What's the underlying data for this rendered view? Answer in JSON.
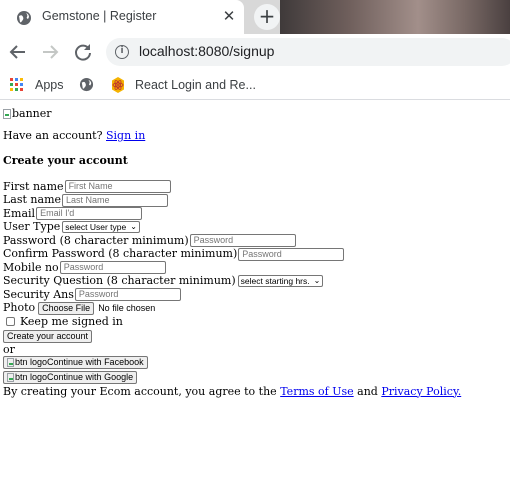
{
  "browser": {
    "tab_title": "Gemstone | Register",
    "tab_close": "✕",
    "new_tab": "+",
    "url": "localhost:8080/signup",
    "bookmarks": [
      {
        "label": "Apps",
        "icon": "apps-grid-icon"
      },
      {
        "label": "",
        "icon": "globe-icon"
      },
      {
        "label": "React Login and Re...",
        "icon": "react-icon"
      }
    ]
  },
  "page": {
    "banner_alt": "banner",
    "have_account": "Have an account?",
    "sign_in": "Sign in",
    "create_title": "Create your account",
    "fields": {
      "first_name": {
        "label": "First name",
        "placeholder": "First Name"
      },
      "last_name": {
        "label": "Last name",
        "placeholder": "Last Name"
      },
      "email": {
        "label": "Email",
        "placeholder": "Email I'd"
      },
      "user_type": {
        "label": "User Type",
        "selected": "select User type"
      },
      "password": {
        "label": "Password (8 character minimum)",
        "placeholder": "Password"
      },
      "confirm_password": {
        "label": "Confirm Password (8 character minimum)",
        "placeholder": "Password"
      },
      "mobile": {
        "label": "Mobile no",
        "placeholder": "Password"
      },
      "security_question": {
        "label": "Security Question (8 character minimum)",
        "selected": "select starting hrs."
      },
      "security_answer": {
        "label": "Security Ans",
        "placeholder": "Password"
      },
      "photo": {
        "label": "Photo",
        "button": "Choose File",
        "status": "No file chosen"
      }
    },
    "keep_signed_in": "Keep me signed in",
    "create_button": "Create your account",
    "or": "or",
    "btn_logo_alt": "btn logo",
    "facebook_button": "Continue with Facebook",
    "google_button": "Continue with Google",
    "terms_prefix": "By creating your Ecom account, you agree to the",
    "terms_link": "Terms of Use",
    "and": "and",
    "privacy_link": "Privacy Policy."
  },
  "colors": {
    "link": "#0000ee",
    "chrome_bg": "#d8d8d8",
    "omnibox_bg": "#f1f3f4"
  }
}
